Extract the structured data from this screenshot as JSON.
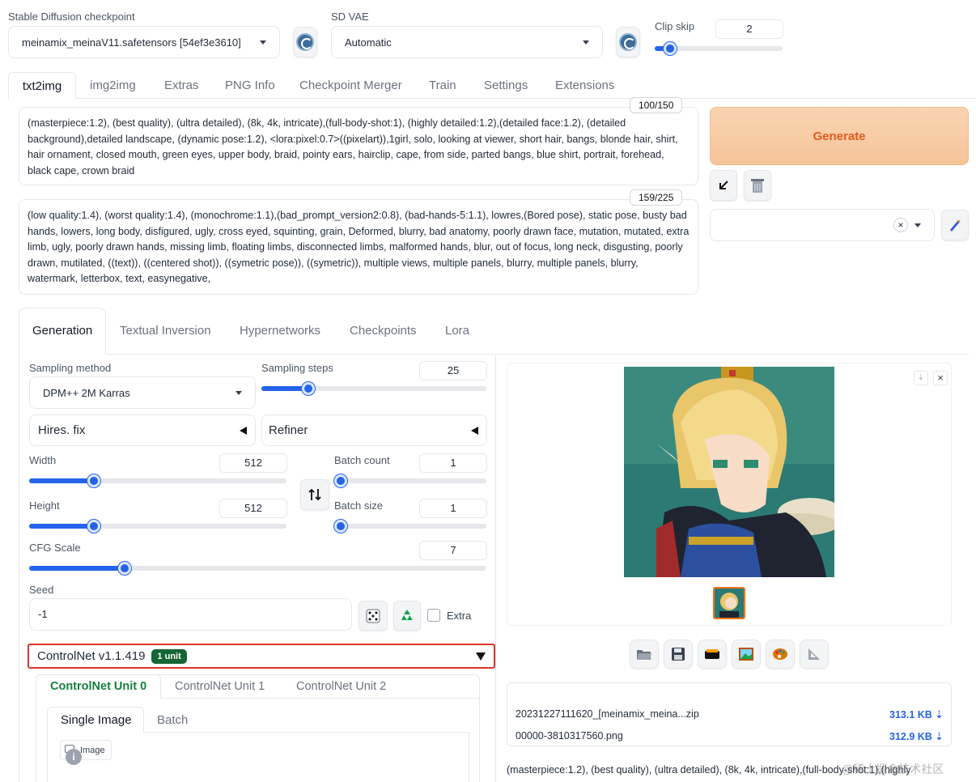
{
  "top": {
    "checkpoint_label": "Stable Diffusion checkpoint",
    "checkpoint_value": "meinamix_meinaV11.safetensors [54ef3e3610]",
    "vae_label": "SD VAE",
    "vae_value": "Automatic",
    "clip_label": "Clip skip",
    "clip_value": "2",
    "clip_level": 0.08
  },
  "tabs": [
    "txt2img",
    "img2img",
    "Extras",
    "PNG Info",
    "Checkpoint Merger",
    "Train",
    "Settings",
    "Extensions"
  ],
  "prompt": {
    "counter": "100/150",
    "text": "(masterpiece:1.2), (best quality), (ultra detailed), (8k, 4k, intricate),(full-body-shot:1), (highly detailed:1.2),(detailed face:1.2), (detailed background),detailed landscape, (dynamic pose:1.2), <lora:pixel:0.7>((pixelart)),1girl, solo, looking at viewer, short hair, bangs, blonde hair, shirt, hair ornament, closed mouth, green eyes, upper body, braid, pointy ears, hairclip, cape, from side, parted bangs, blue shirt, portrait, forehead, black cape, crown braid"
  },
  "negative": {
    "counter": "159/225",
    "text": "(low quality:1.4), (worst quality:1.4), (monochrome:1.1),(bad_prompt_version2:0.8), (bad-hands-5:1.1), lowres,(Bored pose), static pose, busty bad hands, lowers, long body, disfigured, ugly, cross eyed, squinting, grain, Deformed, blurry, bad anatomy, poorly drawn face, mutation, mutated, extra limb, ugly, poorly drawn hands, missing limb, floating limbs, disconnected limbs, malformed hands, blur, out of focus, long neck, disgusting, poorly drawn, mutilated, ((text)), ((centered shot)), ((symetric pose)), ((symetric)), multiple views, multiple panels, blurry, multiple panels, blurry, watermark, letterbox, text, easynegative,"
  },
  "generate_label": "Generate",
  "subtabs": [
    "Generation",
    "Textual Inversion",
    "Hypernetworks",
    "Checkpoints",
    "Lora"
  ],
  "gen": {
    "sampling_method_label": "Sampling method",
    "sampling_method_value": "DPM++ 2M Karras",
    "sampling_steps_label": "Sampling steps",
    "sampling_steps_value": "25",
    "sampling_steps_level": 0.19,
    "hires_label": "Hires. fix",
    "refiner_label": "Refiner",
    "width_label": "Width",
    "width_value": "512",
    "width_level": 0.24,
    "height_label": "Height",
    "height_value": "512",
    "height_level": 0.24,
    "batch_count_label": "Batch count",
    "batch_count_value": "1",
    "batch_count_level": 0.0,
    "batch_size_label": "Batch size",
    "batch_size_value": "1",
    "batch_size_level": 0.0,
    "cfg_label": "CFG Scale",
    "cfg_value": "7",
    "cfg_level": 0.2,
    "seed_label": "Seed",
    "seed_value": "-1",
    "extra_label": "Extra"
  },
  "controlnet": {
    "title": "ControlNet v1.1.419",
    "badge": "1 unit",
    "units": [
      "ControlNet Unit 0",
      "ControlNet Unit 1",
      "ControlNet Unit 2"
    ],
    "modes": [
      "Single Image",
      "Batch"
    ],
    "image_label": "Image"
  },
  "output": {
    "files": [
      {
        "name": "20231227111620_[meinamix_meina...zip",
        "size": "313.1 KB ⇣"
      },
      {
        "name": "00000-3810317560.png",
        "size": "312.9 KB ⇣"
      }
    ],
    "info_text": "(masterpiece:1.2), (best quality), (ultra detailed), (8k, 4k, intricate),(full-body-shot:1),(highly"
  },
  "watermark": "@稀土掘金技术社区",
  "colors": {
    "accent": "#2563eb",
    "generate": "#f6c9a0",
    "generate_text": "#e25b1c",
    "badge": "#16a34a",
    "highlight": "#e0332b"
  }
}
